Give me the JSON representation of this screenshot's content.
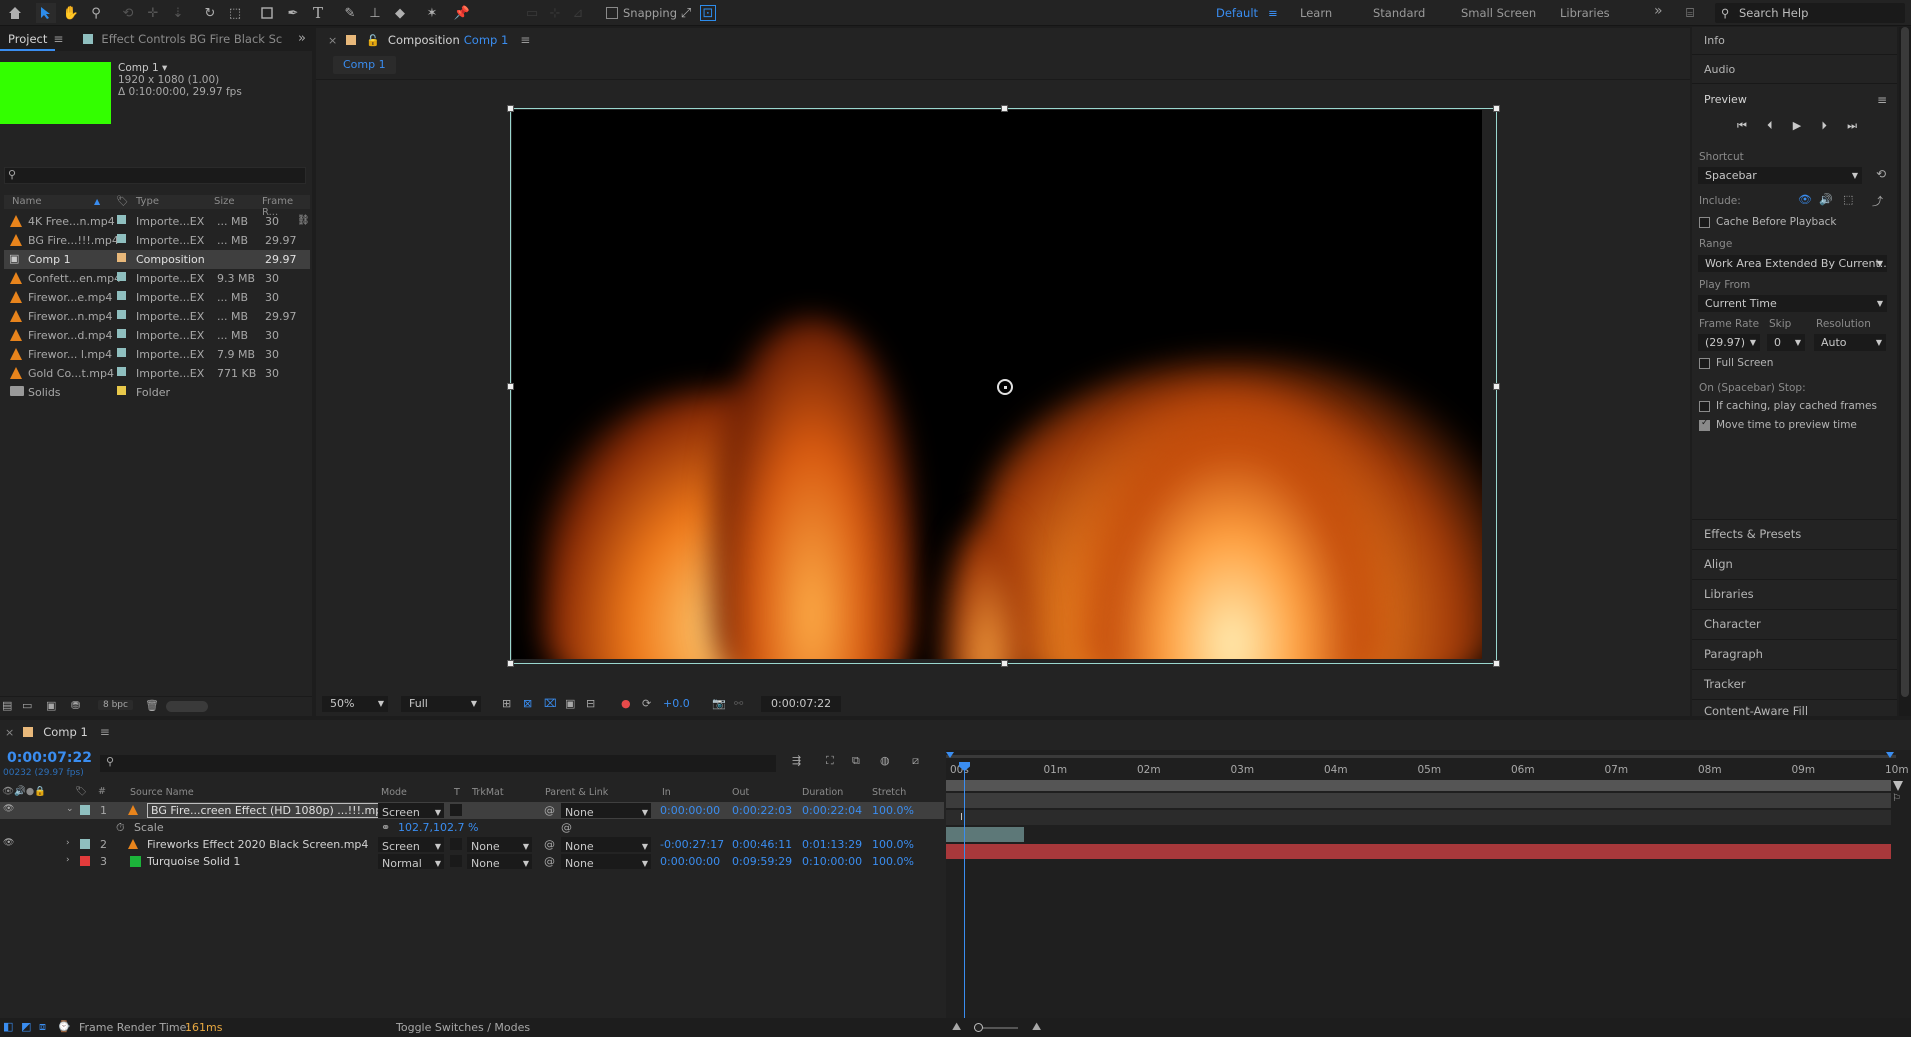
{
  "colors": {
    "accent": "#3a8df0",
    "green_solid": "#33ff00",
    "red_solid": "#a8383b",
    "label_aqua": "#8fbfbf",
    "label_red": "#e23b3b",
    "label_green": "#1cb43a",
    "label_yellow": "#e8c84a"
  },
  "toolbar": {
    "snapping_label": "Snapping",
    "workspaces": [
      "Default",
      "Learn",
      "Standard",
      "Small Screen",
      "Libraries"
    ],
    "active_workspace": "Default",
    "overflow": "»",
    "search_placeholder": "Search Help",
    "icons": [
      "home-icon",
      "selection-tool-icon",
      "hand-tool-icon",
      "zoom-tool-icon",
      "orbit-camera-icon",
      "pan-camera-icon",
      "dolly-camera-icon",
      "rotate-tool-icon",
      "pan-behind-icon",
      "rectangle-tool-icon",
      "pen-tool-icon",
      "type-tool-icon",
      "brush-tool-icon",
      "clone-stamp-icon",
      "eraser-icon",
      "roto-brush-icon",
      "puppet-pin-icon"
    ]
  },
  "project": {
    "tabs": [
      "Project",
      "Effect Controls BG Fire Black Sc"
    ],
    "menu": "≡",
    "overflow": "»",
    "comp_name": "Comp 1 ▾",
    "comp_res": "1920 x 1080 (1.00)",
    "comp_dur": "Δ 0:10:00:00, 29.97 fps",
    "columns": [
      "Name",
      "Type",
      "Size",
      "Frame R..."
    ],
    "items": [
      {
        "name": "4K Free...n.mp4",
        "type": "Importe...EX",
        "size": "... MB",
        "fps": "30",
        "label": "#8fbfbf"
      },
      {
        "name": "BG Fire...!!!.mp4",
        "type": "Importe...EX",
        "size": "... MB",
        "fps": "29.97",
        "label": "#8fbfbf"
      },
      {
        "name": "Comp 1",
        "type": "Composition",
        "size": "",
        "fps": "29.97",
        "label": "#e8b87a"
      },
      {
        "name": "Confett...en.mp4",
        "type": "Importe...EX",
        "size": "9.3 MB",
        "fps": "30",
        "label": "#8fbfbf"
      },
      {
        "name": "Firewor...e.mp4",
        "type": "Importe...EX",
        "size": "... MB",
        "fps": "30",
        "label": "#8fbfbf"
      },
      {
        "name": "Firewor...n.mp4",
        "type": "Importe...EX",
        "size": "... MB",
        "fps": "29.97",
        "label": "#8fbfbf"
      },
      {
        "name": "Firewor...d.mp4",
        "type": "Importe...EX",
        "size": "... MB",
        "fps": "30",
        "label": "#8fbfbf"
      },
      {
        "name": "Firewor... l.mp4",
        "type": "Importe...EX",
        "size": "7.9 MB",
        "fps": "30",
        "label": "#8fbfbf"
      },
      {
        "name": "Gold Co...t.mp4",
        "type": "Importe...EX",
        "size": "771 KB",
        "fps": "30",
        "label": "#8fbfbf"
      },
      {
        "name": "Solids",
        "type": "Folder",
        "size": "",
        "fps": "",
        "label": "#e8c84a"
      }
    ],
    "bpc": "8 bpc"
  },
  "viewer": {
    "tab_label": "Composition",
    "tab_comp": "Comp 1",
    "menu": "≡",
    "subtab": "Comp 1",
    "zoom": "50%",
    "resolution": "Full",
    "exposure": "+0.0",
    "timecode": "0:00:07:22"
  },
  "right": {
    "info": "Info",
    "audio": "Audio",
    "preview": "Preview",
    "shortcut_label": "Shortcut",
    "shortcut_value": "Spacebar",
    "include_label": "Include:",
    "cache_label": "Cache Before Playback",
    "range_label": "Range",
    "range_value": "Work Area Extended By Current...",
    "play_from_label": "Play From",
    "play_from_value": "Current Time",
    "frame_rate_label": "Frame Rate",
    "skip_label": "Skip",
    "resolution_label": "Resolution",
    "frame_rate_value": "(29.97)",
    "skip_value": "0",
    "resolution_value": "Auto",
    "full_screen": "Full Screen",
    "on_stop": "On (Spacebar) Stop:",
    "if_caching": "If caching, play cached frames",
    "move_time": "Move time to preview time",
    "collapsed": [
      "Effects & Presets",
      "Align",
      "Libraries",
      "Character",
      "Paragraph",
      "Tracker",
      "Content-Aware Fill"
    ]
  },
  "timeline": {
    "tab": "Comp 1",
    "menu": "≡",
    "timecode": "0:00:07:22",
    "frames": "00232 (29.97 fps)",
    "columns": [
      "Source Name",
      "Mode",
      "T",
      "TrkMat",
      "Parent & Link",
      "In",
      "Out",
      "Duration",
      "Stretch"
    ],
    "ruler": [
      "00s",
      "01m",
      "02m",
      "03m",
      "04m",
      "05m",
      "06m",
      "07m",
      "08m",
      "09m",
      "10m"
    ],
    "layers": [
      {
        "num": "1",
        "name": "BG Fire...creen Effect (HD 1080p) ...!!!.mp4",
        "mode": "Screen",
        "trkmat": "",
        "parent": "None",
        "in": "0:00:00:00",
        "out": "0:00:22:03",
        "dur": "0:00:22:04",
        "stretch": "100.0%",
        "label": "#8fbfbf",
        "type": "video"
      },
      {
        "num": "2",
        "name": "Fireworks Effect 2020 Black Screen.mp4",
        "mode": "Screen",
        "trkmat": "None",
        "parent": "None",
        "in": "-0:00:27:17",
        "out": "0:00:46:11",
        "dur": "0:01:13:29",
        "stretch": "100.0%",
        "label": "#8fbfbf",
        "type": "video"
      },
      {
        "num": "3",
        "name": "Turquoise Solid 1",
        "mode": "Normal",
        "trkmat": "None",
        "parent": "None",
        "in": "0:00:00:00",
        "out": "0:09:59:29",
        "dur": "0:10:00:00",
        "stretch": "100.0%",
        "label": "#e23b3b",
        "type": "solid"
      }
    ],
    "scale_label": "Scale",
    "scale_value": "102.7,102.7 %"
  },
  "status": {
    "frame_render_label": "Frame Render Time:",
    "frame_render_value": "161ms",
    "toggle": "Toggle Switches / Modes"
  }
}
